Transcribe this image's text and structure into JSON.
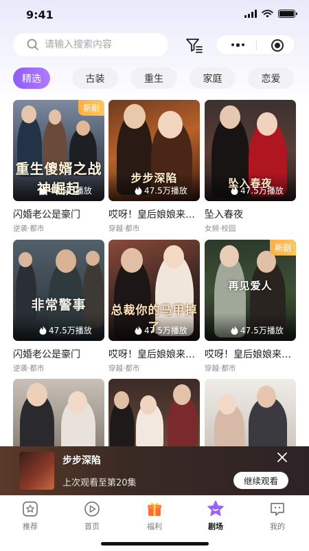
{
  "status_bar": {
    "time": "9:41"
  },
  "search": {
    "placeholder": "请输入搜索内容"
  },
  "category_tabs": [
    "精选",
    "古装",
    "重生",
    "家庭",
    "恋爱"
  ],
  "dramas": [
    {
      "title": "闪婚老公是豪门",
      "tags": "逆袭·都市",
      "plays": "47.5万播放",
      "badge": "新剧",
      "poster_text": "重生傻婿之战神崛起"
    },
    {
      "title": "哎呀！皇后娘娘来…",
      "tags": "穿越·都市",
      "plays": "47.5万播放",
      "badge": "",
      "poster_text": "步步深陷"
    },
    {
      "title": "坠入春夜",
      "tags": "女频·校园",
      "plays": "47.5万播放",
      "badge": "",
      "poster_text": "坠入春夜"
    },
    {
      "title": "闪婚老公是豪门",
      "tags": "逆袭·都市",
      "plays": "47.5万播放",
      "badge": "",
      "poster_text": "非常警事"
    },
    {
      "title": "哎呀！皇后娘娘来…",
      "tags": "穿越·都市",
      "plays": "47.5万播放",
      "badge": "",
      "poster_text": "总裁你的马甲掉了"
    },
    {
      "title": "哎呀！皇后娘娘来…",
      "tags": "穿越·都市",
      "plays": "47.5万播放",
      "badge": "新剧",
      "poster_text": "再见爱人"
    }
  ],
  "continue_watching": {
    "title": "步步深陷",
    "progress_text": "上次观看至第20集",
    "button_label": "继续观看"
  },
  "bottom_nav": [
    "推荐",
    "首页",
    "福利",
    "剧场",
    "我的"
  ],
  "active_nav": "剧场",
  "colors": {
    "accent": "#9a63f8",
    "badge": "#ffb44f"
  }
}
